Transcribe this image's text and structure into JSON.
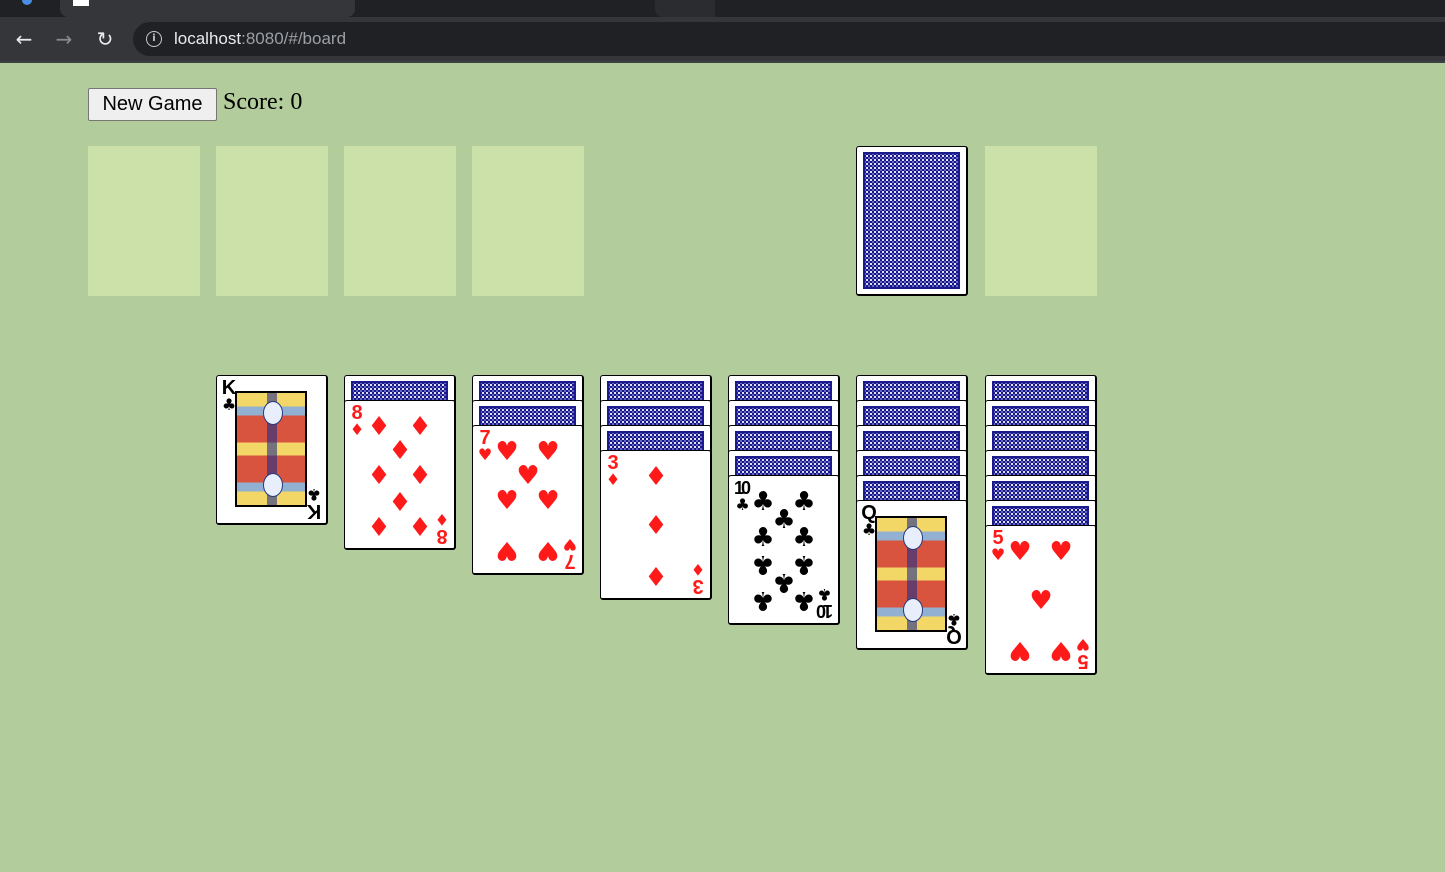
{
  "browser": {
    "url_host": "localhost",
    "url_rest": ":8080/#/board",
    "icons": {
      "back": "arrow-left-icon",
      "forward": "arrow-right-icon",
      "reload": "reload-icon",
      "info": "info-icon"
    }
  },
  "header": {
    "new_game_label": "New Game",
    "score_label": "Score: 0"
  },
  "colors": {
    "felt": "#b2cc9b",
    "slot": "#cbe1a9",
    "card_back": "#16168a",
    "red_suit": "#ff1a1a",
    "black_suit": "#000000"
  },
  "foundations": [
    {
      "empty": true
    },
    {
      "empty": true
    },
    {
      "empty": true
    },
    {
      "empty": true
    }
  ],
  "stock": {
    "face_down": true
  },
  "waste": {
    "empty": true
  },
  "tableau": [
    {
      "hidden": 0,
      "card": {
        "rank": "K",
        "suit": "♣",
        "color": "black",
        "face_card": true
      }
    },
    {
      "hidden": 1,
      "card": {
        "rank": "8",
        "suit": "♦",
        "color": "red"
      }
    },
    {
      "hidden": 2,
      "card": {
        "rank": "7",
        "suit": "♥",
        "color": "red"
      }
    },
    {
      "hidden": 3,
      "card": {
        "rank": "3",
        "suit": "♦",
        "color": "red"
      }
    },
    {
      "hidden": 4,
      "card": {
        "rank": "10",
        "suit": "♣",
        "color": "black"
      }
    },
    {
      "hidden": 5,
      "card": {
        "rank": "Q",
        "suit": "♣",
        "color": "black",
        "face_card": true
      }
    },
    {
      "hidden": 6,
      "card": {
        "rank": "5",
        "suit": "♥",
        "color": "red"
      }
    }
  ]
}
